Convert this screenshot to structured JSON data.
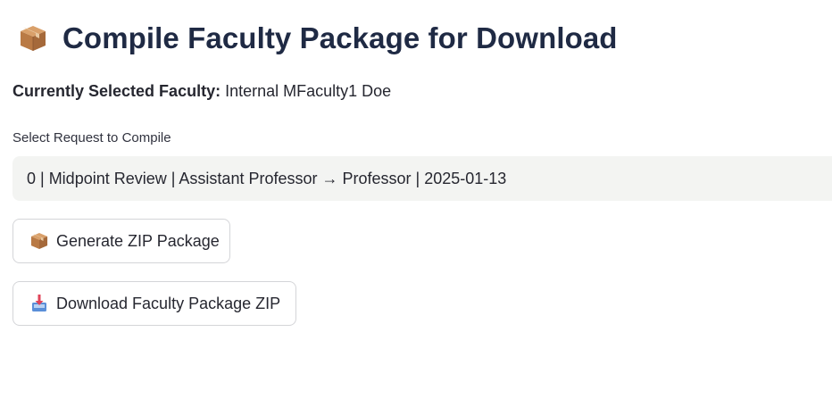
{
  "header": {
    "title": "Compile Faculty Package for Download",
    "title_icon": "package-icon"
  },
  "faculty": {
    "label": "Currently Selected Faculty:",
    "value": "Internal MFaculty1 Doe"
  },
  "request_select": {
    "caption": "Select Request to Compile",
    "selected_value": "0 | Midpoint Review | Assistant Professor → Professor | 2025-01-13"
  },
  "buttons": {
    "generate": {
      "label": "Generate ZIP Package",
      "icon": "package-icon"
    },
    "download": {
      "label": "Download Faculty Package ZIP",
      "icon": "inbox-tray-icon"
    }
  },
  "colors": {
    "title": "#1f2a44",
    "text": "#262730",
    "select_bg": "#f3f4f2",
    "button_border": "#d4d5d8",
    "package_brown": "#c68a52",
    "tray_blue": "#5a8fd8",
    "tray_arrow_red": "#e0445a"
  }
}
